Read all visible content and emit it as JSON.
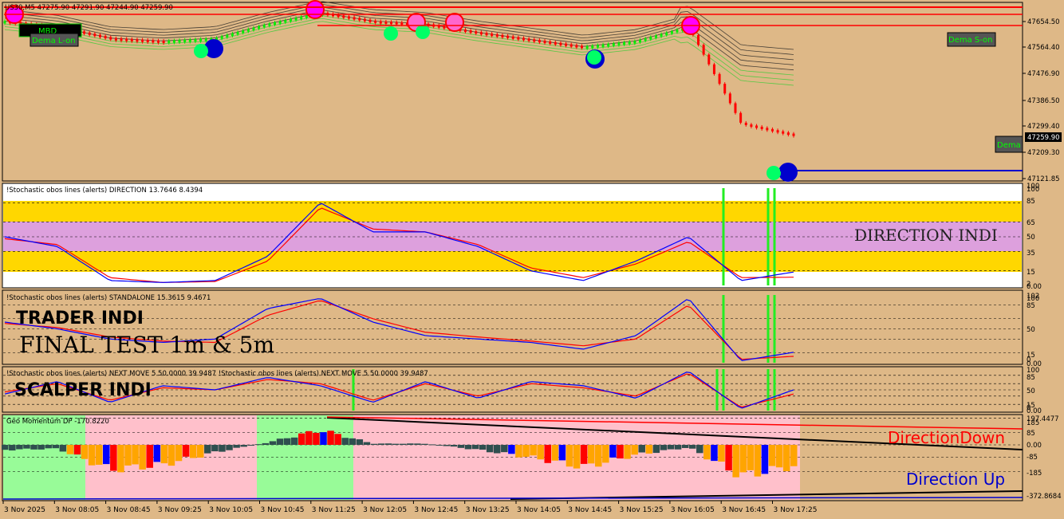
{
  "main": {
    "symbol_info": "US30,M5  47275.90 47291.90 47244.90 47259.90",
    "price_ticks": [
      "47654.50",
      "47564.40",
      "47476.90",
      "47386.50",
      "47299.40",
      "47209.30",
      "47121.85"
    ],
    "current_price": "47259.90",
    "button_mbd": "MBD",
    "label_dema_l": "Dema L-on",
    "label_dema_s": "Dema S-on",
    "label_dema": "Dema"
  },
  "panels": {
    "direction": {
      "header": "!Stochastic obos lines (alerts) DIRECTION 13.7646 8.4394",
      "label": "DIRECTION INDI",
      "ticks": [
        "100",
        "100",
        "85",
        "65",
        "50",
        "35",
        "15",
        "2",
        "0.00"
      ]
    },
    "standalone": {
      "header": "!Stochastic obos lines (alerts) STANDALONE 15.3615 9.4671",
      "title": "TRADER INDI",
      "subtitle": "FINAL TEST 1m & 5m",
      "ticks": [
        "102",
        "100",
        "85",
        "50",
        "15",
        "0",
        "0.00"
      ]
    },
    "next_move": {
      "header": "!Stochastic obos lines (alerts) NEXT MOVE 5 50.0000 39.9487  !Stochastic obos lines (alerts) NEXT MOVE 5 50.0000 39.9487",
      "title": "SCALPER INDI",
      "ticks": [
        "100",
        "85",
        "50",
        "15",
        "0",
        "0.00"
      ]
    },
    "geo": {
      "header": "Geo Momentum DP  -170.8220",
      "ticks": [
        "197.4477",
        "185",
        "85",
        "0.00",
        "-85",
        "-185",
        "-372.8684"
      ],
      "label_down": "DirectionDown",
      "label_up": "Direction Up"
    }
  },
  "time_axis": [
    "3 Nov 2025",
    "3 Nov 08:05",
    "3 Nov 08:45",
    "3 Nov 09:25",
    "3 Nov 10:05",
    "3 Nov 10:45",
    "3 Nov 11:25",
    "3 Nov 12:05",
    "3 Nov 12:45",
    "3 Nov 13:25",
    "3 Nov 14:05",
    "3 Nov 14:45",
    "3 Nov 15:25",
    "3 Nov 16:05",
    "3 Nov 16:45",
    "3 Nov 17:25"
  ],
  "colors": {
    "background": "#deb887",
    "bull": "#00ee00",
    "bear": "#ff0000",
    "stoch_main": "#0000ff",
    "stoch_signal": "#ff0000",
    "band_yellow": "#ffd700",
    "band_violet": "#dda0dd",
    "zone_green": "#98fb98",
    "zone_pink": "#ffc0cb",
    "hist_dark": "#2f4f4f",
    "hist_orange": "#ffa500",
    "hist_red": "#ff0000",
    "hist_blue": "#0000ff"
  },
  "chart_data": [
    {
      "type": "candlestick",
      "title": "US30,M5",
      "ylim": [
        47100,
        47720
      ],
      "x": [
        "3 Nov 2025",
        "3 Nov 08:05",
        "3 Nov 08:45",
        "3 Nov 09:25",
        "3 Nov 10:05",
        "3 Nov 10:45",
        "3 Nov 11:25",
        "3 Nov 12:05",
        "3 Nov 12:45",
        "3 Nov 13:25",
        "3 Nov 14:05",
        "3 Nov 14:45",
        "3 Nov 15:25",
        "3 Nov 16:05",
        "3 Nov 16:45",
        "3 Nov 17:25"
      ],
      "close": [
        47660,
        47640,
        47600,
        47590,
        47600,
        47650,
        47690,
        47660,
        47650,
        47620,
        47595,
        47570,
        47590,
        47640,
        47300,
        47259.9
      ],
      "last_price": 47259.9,
      "support_line": 47140
    },
    {
      "type": "line",
      "title": "DIRECTION",
      "ylim": [
        0,
        100
      ],
      "x": [
        "3 Nov 2025",
        "3 Nov 08:05",
        "3 Nov 08:45",
        "3 Nov 09:25",
        "3 Nov 10:05",
        "3 Nov 10:45",
        "3 Nov 11:25",
        "3 Nov 12:05",
        "3 Nov 12:45",
        "3 Nov 13:25",
        "3 Nov 14:05",
        "3 Nov 14:45",
        "3 Nov 15:25",
        "3 Nov 16:05",
        "3 Nov 16:45",
        "3 Nov 17:25"
      ],
      "series": [
        {
          "values": [
            50,
            40,
            5,
            3,
            5,
            30,
            85,
            55,
            55,
            40,
            15,
            5,
            25,
            50,
            5,
            13.76
          ]
        },
        {
          "values": [
            48,
            42,
            8,
            3,
            4,
            25,
            80,
            58,
            55,
            42,
            18,
            8,
            22,
            45,
            8,
            8.44
          ]
        }
      ]
    },
    {
      "type": "line",
      "title": "STANDALONE",
      "ylim": [
        0,
        100
      ],
      "x": [
        "3 Nov 2025",
        "3 Nov 08:05",
        "3 Nov 08:45",
        "3 Nov 09:25",
        "3 Nov 10:05",
        "3 Nov 10:45",
        "3 Nov 11:25",
        "3 Nov 12:05",
        "3 Nov 12:45",
        "3 Nov 13:25",
        "3 Nov 14:05",
        "3 Nov 14:45",
        "3 Nov 15:25",
        "3 Nov 16:05",
        "3 Nov 16:45",
        "3 Nov 17:25"
      ],
      "series": [
        {
          "values": [
            60,
            50,
            35,
            30,
            35,
            80,
            95,
            60,
            40,
            35,
            30,
            20,
            40,
            95,
            3,
            15.36
          ]
        },
        {
          "values": [
            58,
            52,
            38,
            32,
            30,
            70,
            92,
            65,
            45,
            38,
            32,
            25,
            35,
            85,
            5,
            9.47
          ]
        }
      ]
    },
    {
      "type": "line",
      "title": "NEXT MOVE 5",
      "ylim": [
        0,
        100
      ],
      "x": [
        "3 Nov 2025",
        "3 Nov 08:05",
        "3 Nov 08:45",
        "3 Nov 09:25",
        "3 Nov 10:05",
        "3 Nov 10:45",
        "3 Nov 11:25",
        "3 Nov 12:05",
        "3 Nov 12:45",
        "3 Nov 13:25",
        "3 Nov 14:05",
        "3 Nov 14:45",
        "3 Nov 15:25",
        "3 Nov 16:05",
        "3 Nov 16:45",
        "3 Nov 17:25"
      ],
      "series": [
        {
          "values": [
            40,
            70,
            20,
            60,
            50,
            80,
            60,
            20,
            70,
            30,
            70,
            60,
            30,
            95,
            5,
            50
          ]
        },
        {
          "values": [
            45,
            65,
            25,
            55,
            50,
            75,
            65,
            25,
            65,
            35,
            65,
            55,
            35,
            90,
            8,
            39.95
          ]
        }
      ]
    },
    {
      "type": "bar",
      "title": "Geo Momentum DP",
      "ylim": [
        -372.8684,
        197.4477
      ],
      "x": [
        "3 Nov 2025",
        "3 Nov 08:05",
        "3 Nov 08:45",
        "3 Nov 09:25",
        "3 Nov 10:05",
        "3 Nov 10:45",
        "3 Nov 11:25",
        "3 Nov 12:05",
        "3 Nov 12:45",
        "3 Nov 13:25",
        "3 Nov 14:05",
        "3 Nov 14:45",
        "3 Nov 15:25",
        "3 Nov 16:05",
        "3 Nov 16:45",
        "3 Nov 17:25"
      ],
      "values": [
        -40,
        -30,
        -200,
        -160,
        -60,
        20,
        120,
        10,
        10,
        -40,
        -100,
        -180,
        -80,
        -20,
        -250,
        -170.82
      ]
    }
  ]
}
